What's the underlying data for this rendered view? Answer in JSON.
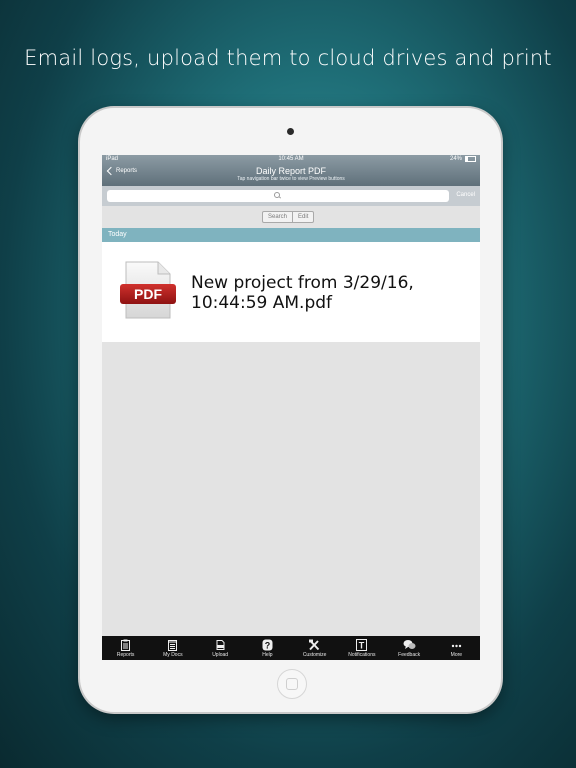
{
  "headline": "Email logs, upload them to cloud drives and print",
  "status_bar": {
    "device": "iPad",
    "time": "10:45 AM",
    "battery": "24%"
  },
  "nav": {
    "back_label": "Reports",
    "title": "Daily Report PDF",
    "subtitle": "Tap navigation bar twice to view Preview buttons"
  },
  "search": {
    "placeholder": "",
    "cancel_label": "Cancel"
  },
  "segmented": {
    "search_label": "Search",
    "edit_label": "Edit"
  },
  "section": {
    "header": "Today"
  },
  "files": [
    {
      "name": "New project from 3/29/16, 10:44:59 AM.pdf",
      "icon_label": "PDF"
    }
  ],
  "tabs": [
    {
      "label": "Reports",
      "icon": "clipboard-icon"
    },
    {
      "label": "My Docs",
      "icon": "notepad-icon"
    },
    {
      "label": "Upload",
      "icon": "upload-icon"
    },
    {
      "label": "Help",
      "icon": "question-icon"
    },
    {
      "label": "Customize",
      "icon": "tools-icon"
    },
    {
      "label": "Notifications",
      "icon": "notification-icon"
    },
    {
      "label": "Feedback",
      "icon": "chat-bubbles-icon"
    },
    {
      "label": "More",
      "icon": "more-icon"
    }
  ],
  "colors": {
    "section_header": "#7fb3bf",
    "pdf_badge": "#b71c1c",
    "tab_bar": "#111111"
  }
}
